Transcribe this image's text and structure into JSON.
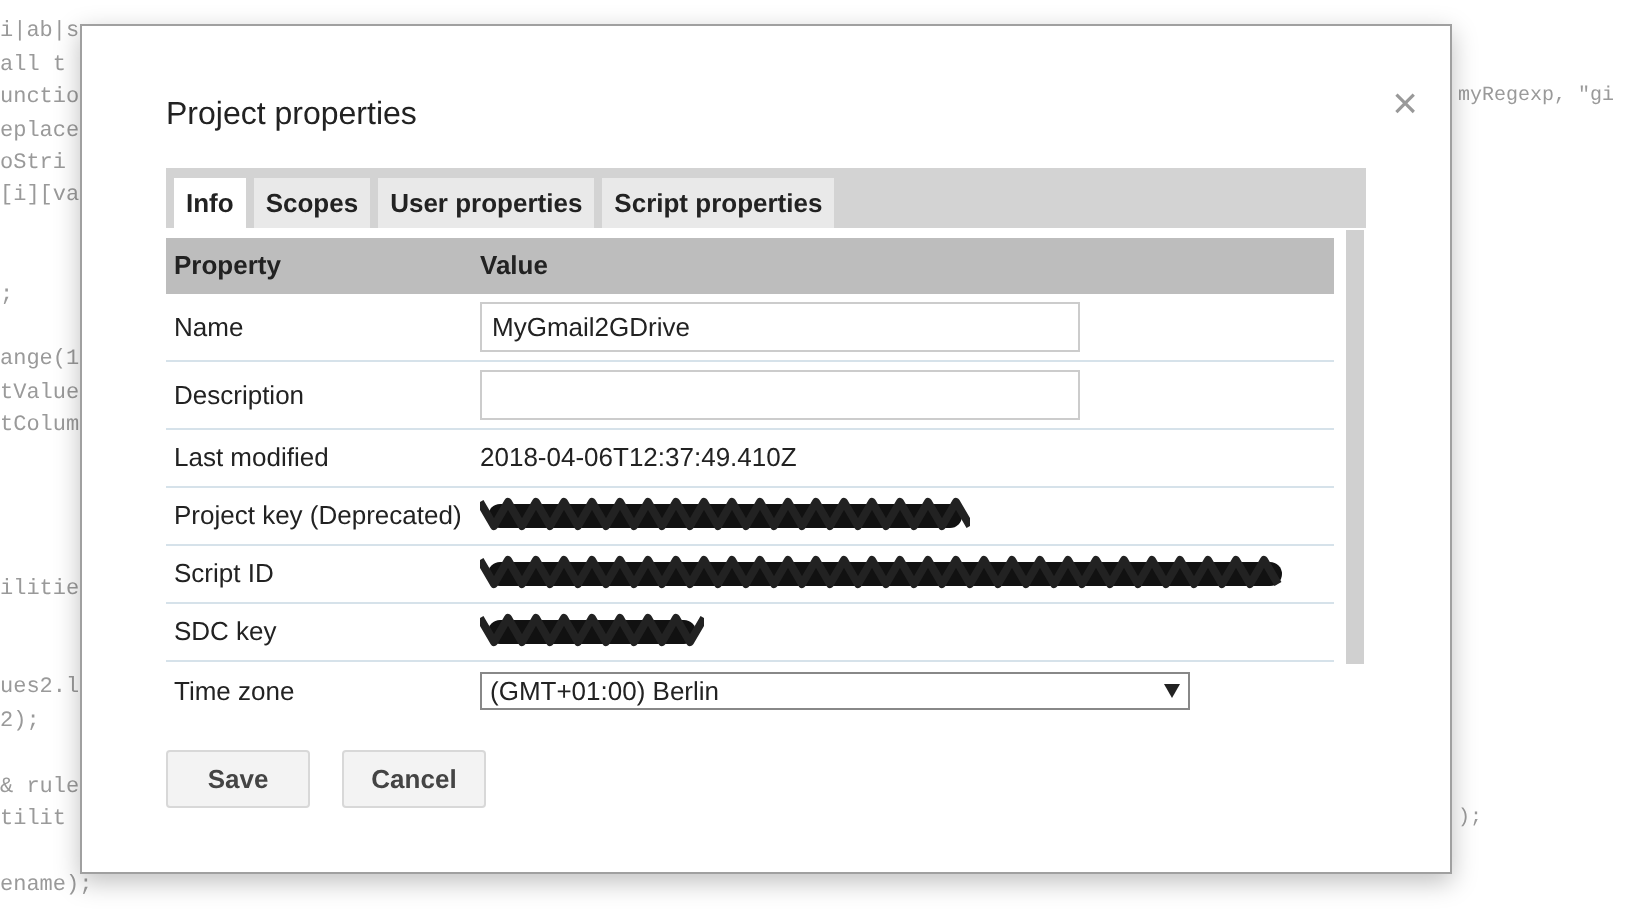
{
  "background_code": {
    "left_lines": [
      "i|ab|s",
      "all t",
      "unctio",
      "eplace",
      "oStri",
      "[i][va",
      ";",
      "ange(1",
      "tValue",
      "tColum",
      "ilitie",
      "ues2.l",
      "2);",
      "& rule",
      "tilit",
      "ename);"
    ],
    "right_lines": [
      "myRegexp, \"gi",
      ");"
    ]
  },
  "dialog": {
    "title": "Project properties",
    "close": "×",
    "tabs": [
      {
        "label": "Info",
        "selected": true
      },
      {
        "label": "Scopes",
        "selected": false
      },
      {
        "label": "User properties",
        "selected": false
      },
      {
        "label": "Script properties",
        "selected": false
      }
    ],
    "table": {
      "columns": [
        "Property",
        "Value"
      ],
      "rows": [
        {
          "kind": "input",
          "property": "Name",
          "value": "MyGmail2GDrive"
        },
        {
          "kind": "input",
          "property": "Description",
          "value": ""
        },
        {
          "kind": "text",
          "property": "Last modified",
          "value": "2018-04-06T12:37:49.410Z"
        },
        {
          "kind": "redacted",
          "property": "Project key (Deprecated)"
        },
        {
          "kind": "redacted",
          "property": "Script ID"
        },
        {
          "kind": "redacted",
          "property": "SDC key"
        },
        {
          "kind": "select",
          "property": "Time zone",
          "value": "(GMT+01:00) Berlin"
        }
      ]
    },
    "buttons": [
      "Save",
      "Cancel"
    ]
  }
}
